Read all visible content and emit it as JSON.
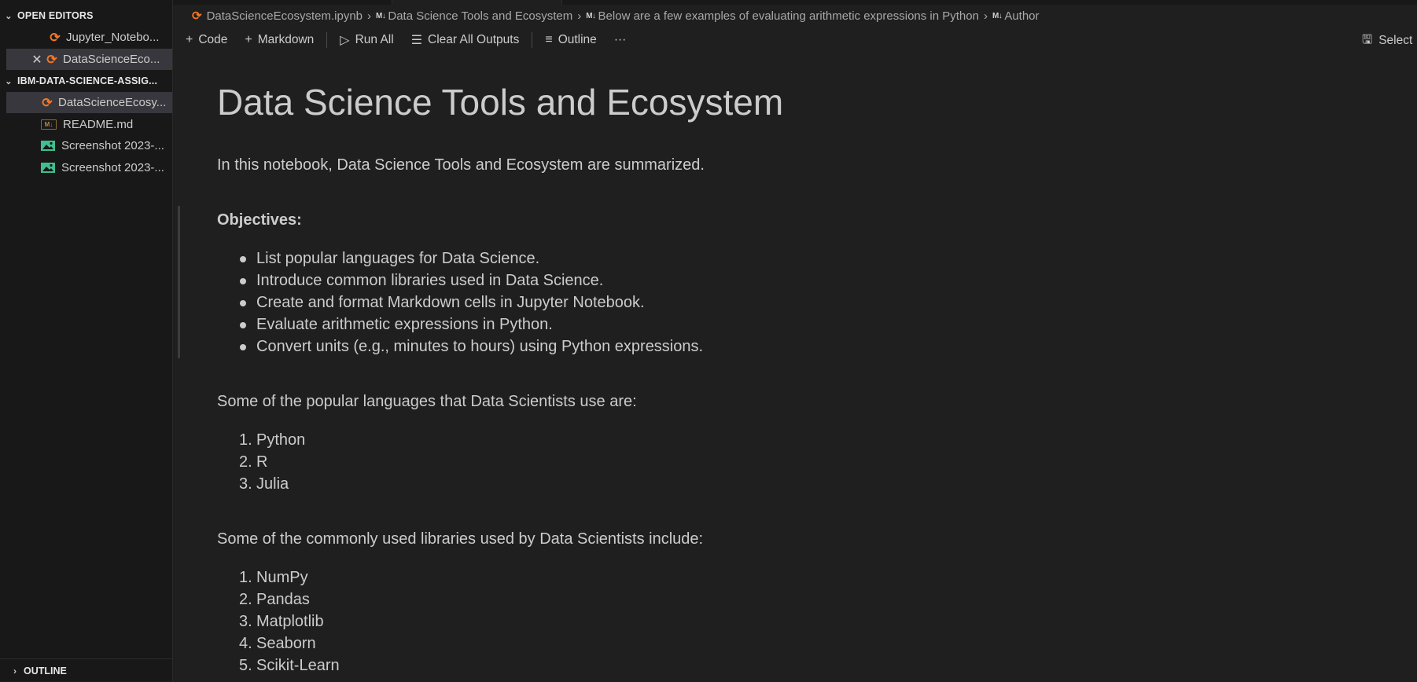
{
  "sidebar": {
    "open_editors_label": "OPEN EDITORS",
    "open_editors": [
      {
        "label": "Jupyter_Notebo..."
      },
      {
        "label": "DataScienceEco..."
      }
    ],
    "folder_label": "IBM-DATA-SCIENCE-ASSIG...",
    "files": [
      {
        "label": "DataScienceEcosy...",
        "type": "notebook"
      },
      {
        "label": "README.md",
        "type": "markdown"
      },
      {
        "label": "Screenshot 2023-...",
        "type": "image"
      },
      {
        "label": "Screenshot 2023-...",
        "type": "image"
      }
    ],
    "outline_label": "OUTLINE"
  },
  "breadcrumb": {
    "file": "DataScienceEcosystem.ipynb",
    "md_badge": "M↓",
    "items": [
      "Data Science Tools and Ecosystem",
      "Below are a few examples of evaluating arithmetic expressions in Python",
      "Author"
    ]
  },
  "toolbar": {
    "code": "Code",
    "markdown": "Markdown",
    "run_all": "Run All",
    "clear_outputs": "Clear All Outputs",
    "outline": "Outline",
    "more": "···",
    "select_kernel": "Select"
  },
  "notebook": {
    "title": "Data Science Tools and Ecosystem",
    "intro": "In this notebook, Data Science Tools and Ecosystem are summarized.",
    "objectives_heading": "Objectives:",
    "objectives": [
      "List popular languages for Data Science.",
      "Introduce common libraries used in Data Science.",
      "Create and format Markdown cells in Jupyter Notebook.",
      "Evaluate arithmetic expressions in Python.",
      "Convert units (e.g., minutes to hours) using Python expressions."
    ],
    "languages_intro": "Some of the popular languages that Data Scientists use are:",
    "languages": [
      "Python",
      "R",
      "Julia"
    ],
    "libraries_intro": "Some of the commonly used libraries used by Data Scientists include:",
    "libraries": [
      "NumPy",
      "Pandas",
      "Matplotlib",
      "Seaborn",
      "Scikit-Learn"
    ]
  },
  "colors": {
    "background": "#1f1f1f",
    "sidebar": "#181818",
    "jupyter_orange": "#f37626",
    "image_icon": "#3fbf8f",
    "text": "#cccccc"
  }
}
